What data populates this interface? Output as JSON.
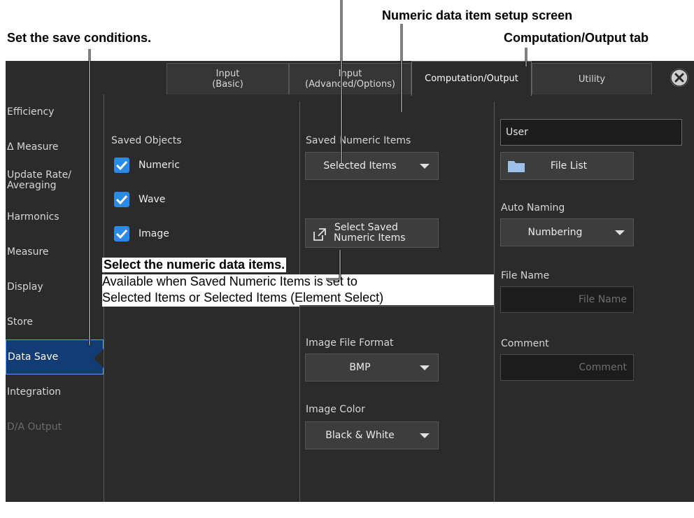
{
  "annotations": {
    "numeric_setup": "Numeric data item setup screen",
    "save_conditions": "Set the save conditions.",
    "comp_tab": "Computation/Output tab",
    "select_items_title": "Select the numeric data items.",
    "select_items_line1": "Available when Saved Numeric Items is set to",
    "select_items_line2": "Selected Items or Selected Items (Element Select)"
  },
  "tabs": {
    "input_basic_1": "Input",
    "input_basic_2": "(Basic)",
    "input_adv_1": "Input",
    "input_adv_2": "(Advanced/Options)",
    "comp_output": "Computation/Output",
    "utility": "Utility"
  },
  "sidebar": {
    "items": [
      "Efficiency",
      "Δ Measure",
      "Update Rate/",
      "Harmonics",
      "Measure",
      "Display",
      "Store",
      "Data Save",
      "Integration",
      "D/A Output"
    ],
    "update_rate_line2": "Averaging"
  },
  "saved_objects": {
    "title": "Saved Objects",
    "numeric": "Numeric",
    "wave": "Wave",
    "image": "Image",
    "numeric_checked": true,
    "wave_checked": true,
    "image_checked": true
  },
  "numeric_items": {
    "title": "Saved Numeric Items",
    "value": "Selected Items",
    "select_btn_1": "Select Saved",
    "select_btn_2": "Numeric Items"
  },
  "image": {
    "format_title": "Image File Format",
    "format_value": "BMP",
    "color_title": "Image Color",
    "color_value": "Black & White"
  },
  "file": {
    "path": "User",
    "file_list": "File List",
    "auto_naming_title": "Auto Naming",
    "auto_naming_value": "Numbering",
    "file_name_title": "File Name",
    "file_name_placeholder": "File Name",
    "comment_title": "Comment",
    "comment_placeholder": "Comment"
  },
  "colors": {
    "accent": "#2a8ae6",
    "active_side": "#123c73",
    "background": "#2b2b2b"
  }
}
